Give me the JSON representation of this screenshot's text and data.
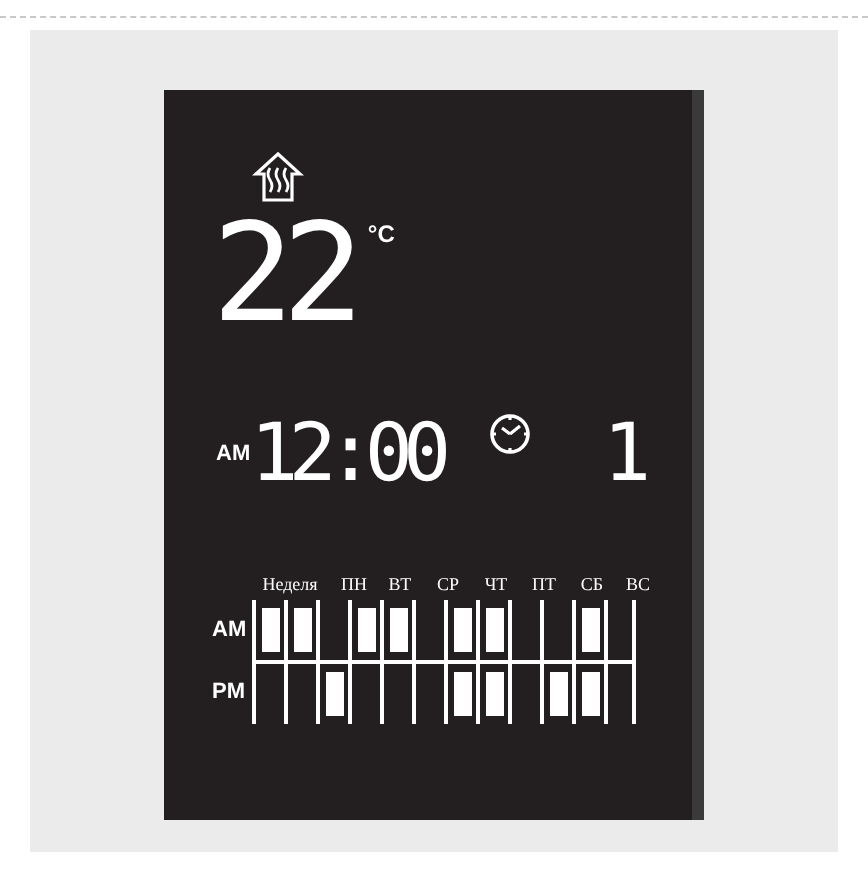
{
  "temperature": "22",
  "unit": "°C",
  "period": "AM",
  "time": "12:00",
  "program": "1",
  "schedule": {
    "columns": [
      "Неделя",
      "ПН",
      "ВТ",
      "СР",
      "ЧТ",
      "ПТ",
      "СБ",
      "ВС"
    ],
    "rows": [
      {
        "label": "AM",
        "slots": [
          {
            "on": true
          },
          {
            "on": true
          },
          {
            "on": false
          },
          {
            "on": true
          },
          {
            "on": true
          },
          {
            "on": false
          },
          {
            "on": true
          },
          {
            "on": true
          },
          {
            "on": false
          },
          {
            "on": false
          },
          {
            "on": true
          },
          {
            "on": false
          }
        ]
      },
      {
        "label": "PM",
        "slots": [
          {
            "on": false
          },
          {
            "on": false
          },
          {
            "on": true
          },
          {
            "on": false
          },
          {
            "on": false
          },
          {
            "on": false
          },
          {
            "on": true
          },
          {
            "on": true
          },
          {
            "on": false
          },
          {
            "on": true
          },
          {
            "on": true
          },
          {
            "on": false
          }
        ]
      }
    ]
  }
}
